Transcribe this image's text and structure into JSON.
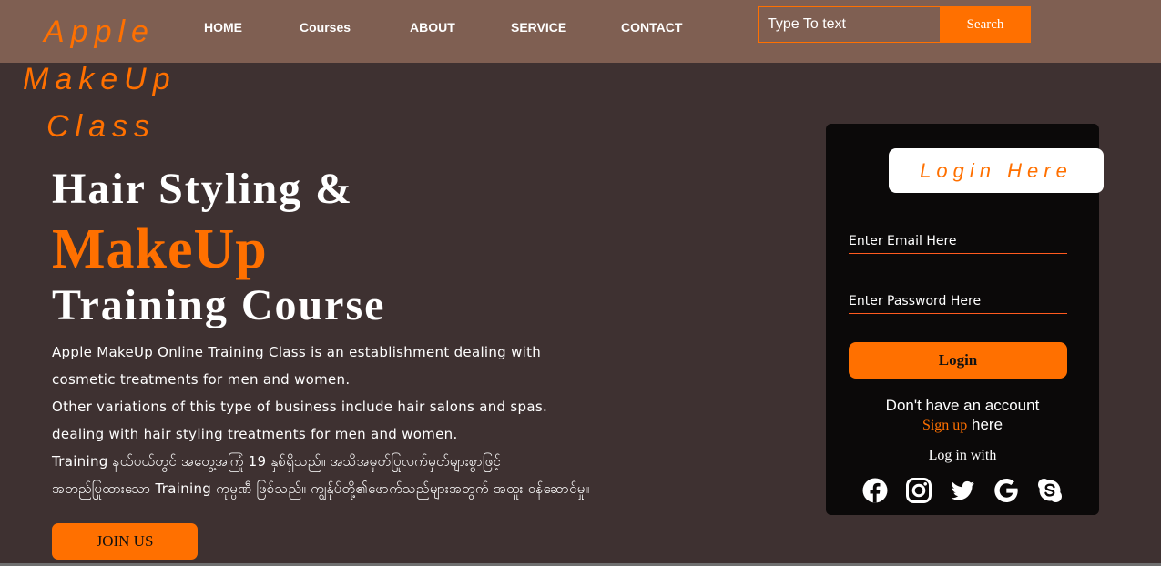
{
  "logo": {
    "line1": "Apple",
    "line2": "MakeUp",
    "line3": "Class"
  },
  "nav": {
    "home": "HOME",
    "courses": "Courses",
    "about": "ABOUT",
    "service": "SERVICE",
    "contact": "CONTACT"
  },
  "search": {
    "placeholder": "Type To text",
    "button": "Search"
  },
  "hero": {
    "line1": "Hair Styling &",
    "line2": "MakeUp",
    "line3": "Training Course"
  },
  "description": {
    "line1": "Apple MakeUp Online Training Class is an establishment dealing with",
    "line2": "cosmetic treatments for men and women.",
    "line3": "Other variations of this type of business include hair salons and spas.",
    "line4": "dealing with hair styling treatments for men and women.",
    "line5": "Training နယ်ပယ်တွင် အတွေ့အကြုံ 19 နှစ်ရှိသည်။ အသိအမှတ်ပြုလက်မှတ်များစွာဖြင့်",
    "line6": "အတည်ပြုထားသော Training ကုမ္ပဏီ ဖြစ်သည်။ ကျွန်ုပ်တို့၏ဖောက်သည်များအတွက် အထူး ဝန်ဆောင်မှု။"
  },
  "join_button": "JOIN US",
  "login": {
    "title": "Login Here",
    "email_placeholder": "Enter Email Here",
    "password_placeholder": "Enter Password Here",
    "button": "Login",
    "no_account": "Don't have an account",
    "signup_link": "Sign up",
    "signup_suffix": " here",
    "login_with": "Log in with"
  },
  "social_icons": [
    "facebook-icon",
    "instagram-icon",
    "twitter-icon",
    "google-icon",
    "skype-icon"
  ],
  "colors": {
    "accent": "#ff7000",
    "navbar": "#7f5f52",
    "background": "#3e3131",
    "card": "#0b0909"
  }
}
